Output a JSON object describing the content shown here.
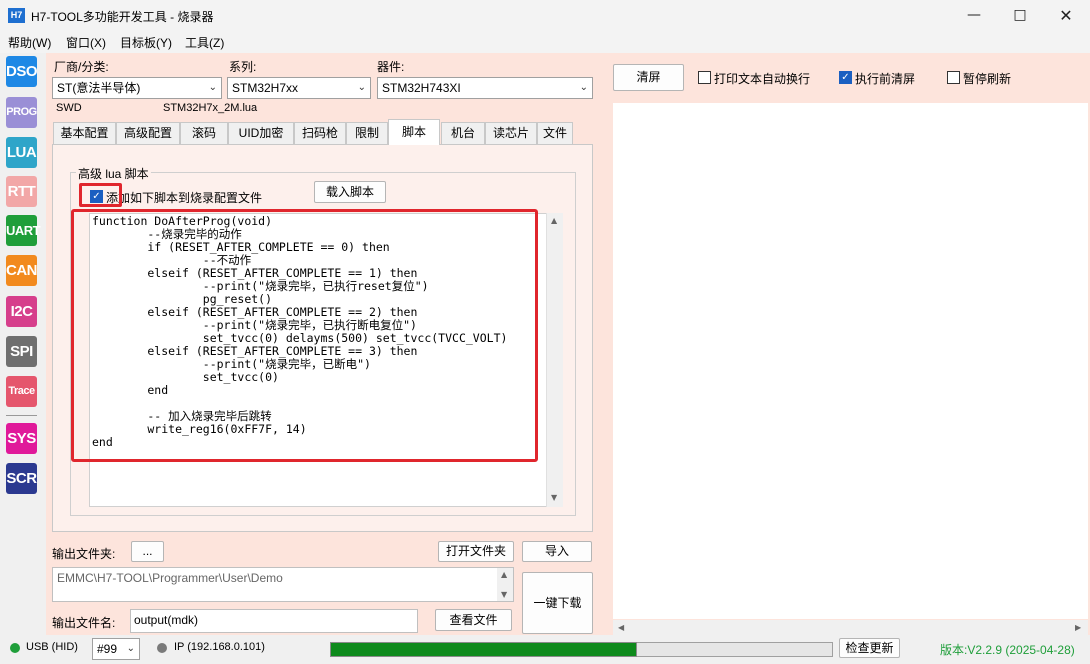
{
  "window": {
    "app_icon_text": "H7",
    "title": "H7-TOOL多功能开发工具 - 烧录器"
  },
  "menu": [
    "帮助(W)",
    "窗口(X)",
    "目标板(Y)",
    "工具(Z)"
  ],
  "sidebar": [
    {
      "label": "DSO",
      "color": "#1e88e5"
    },
    {
      "label": "PROG",
      "color": "#9a8fd6"
    },
    {
      "label": "LUA",
      "color": "#2ea5c9"
    },
    {
      "label": "RTT",
      "color": "#f2a7a7"
    },
    {
      "label": "UART",
      "color": "#1f9e3a"
    },
    {
      "label": "CAN",
      "color": "#f28a1e"
    },
    {
      "label": "I2C",
      "color": "#d63f8c"
    },
    {
      "label": "SPI",
      "color": "#6f6f6f"
    },
    {
      "label": "Trace",
      "color": "#e5566d"
    },
    {
      "label": "SYS",
      "color": "#e0199a"
    },
    {
      "label": "SCR",
      "color": "#2b3990"
    }
  ],
  "selectors": {
    "vendor_label": "厂商/分类:",
    "vendor_value": "ST(意法半导体)",
    "series_label": "系列:",
    "series_value": "STM32H7xx",
    "device_label": "器件:",
    "device_value": "STM32H743XI",
    "interface": "SWD",
    "lua_file": "STM32H7x_2M.lua"
  },
  "tabs": [
    "基本配置",
    "高级配置",
    "滚码",
    "UID加密",
    "扫码枪",
    "限制",
    "脚本",
    "机台",
    "读芯片",
    "文件"
  ],
  "active_tab": "脚本",
  "script": {
    "group_title": "高级 lua 脚本",
    "add_checkbox_label": "添加如下脚本到烧录配置文件",
    "add_checked": true,
    "load_button": "载入脚本",
    "code": "function DoAfterProg(void)\n        --烧录完毕的动作\n        if (RESET_AFTER_COMPLETE == 0) then\n                --不动作\n        elseif (RESET_AFTER_COMPLETE == 1) then\n                --print(\"烧录完毕，已执行reset复位\")\n                pg_reset()\n        elseif (RESET_AFTER_COMPLETE == 2) then\n                --print(\"烧录完毕，已执行断电复位\")\n                set_tvcc(0) delayms(500) set_tvcc(TVCC_VOLT)\n        elseif (RESET_AFTER_COMPLETE == 3) then\n                --print(\"烧录完毕，已断电\")\n                set_tvcc(0)\n        end\n\n        -- 加入烧录完毕后跳转\n        write_reg16(0xFF7F, 14)\nend"
  },
  "output": {
    "folder_label": "输出文件夹:",
    "browse_button": "...",
    "open_folder_button": "打开文件夹",
    "import_button": "导入",
    "path": "EMMC\\H7-TOOL\\Programmer\\User\\Demo",
    "download_button": "一键下载",
    "filename_label": "输出文件名:",
    "filename_value": "output(mdk)",
    "view_file_button": "查看文件"
  },
  "right": {
    "clear_button": "清屏",
    "wrap_label": "打印文本自动换行",
    "wrap_checked": false,
    "clear_before_label": "执行前清屏",
    "clear_before_checked": true,
    "pause_label": "暂停刷新",
    "pause_checked": false
  },
  "status": {
    "usb_label": "USB (HID)",
    "usb_color": "#1f9e3a",
    "port_value": "#99",
    "ip_label": "IP (192.168.0.101)",
    "ip_color": "#7a7a7a",
    "progress": 0.61,
    "check_update_button": "检查更新",
    "version": "版本:V2.2.9 (2025-04-28)",
    "version_color": "#1f9e3a"
  }
}
